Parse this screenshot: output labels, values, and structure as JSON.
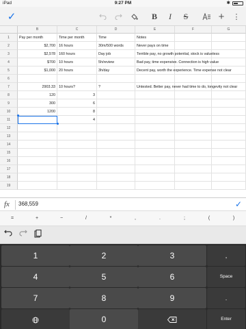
{
  "status_bar": {
    "device": "iPad",
    "time": "9:27 PM"
  },
  "toolbar": {
    "done_icon": "checkmark-icon",
    "undo_icon": "undo-icon",
    "redo_icon": "redo-icon",
    "fill_icon": "paint-bucket-icon",
    "bold_label": "B",
    "italic_label": "I",
    "strike_label": "S",
    "format_icon": "text-format-icon",
    "add_icon": "plus-icon",
    "more_icon": "more-vert-icon"
  },
  "sheet": {
    "columns": [
      "B",
      "C",
      "D",
      "E",
      "F",
      "G"
    ],
    "rows": [
      "1",
      "2",
      "3",
      "4",
      "5",
      "6",
      "7",
      "8",
      "9",
      "10",
      "11",
      "12",
      "13",
      "14",
      "15",
      "16",
      "17",
      "18",
      "19"
    ],
    "header_row": {
      "b": "Pay per month",
      "c": "Time per month",
      "d": "Time",
      "e": "Notes"
    },
    "data": [
      {
        "row": 2,
        "b": "$2,700",
        "c": "16 hours",
        "d": "30m/500 words",
        "e": "Never pays on time"
      },
      {
        "row": 3,
        "b": "$2,578",
        "c": "160 hours",
        "d": "Day job",
        "e": "Terrible pay, no growth potential, stock is valueless"
      },
      {
        "row": 4,
        "b": "$700",
        "c": "10 hours",
        "d": "5h/review",
        "e": "Bad pay, time expensive. Connection is high value"
      },
      {
        "row": 5,
        "b": "$1,000",
        "c": "20 hours",
        "d": "3h/day",
        "e": "Decent pay, worth the experience. Time expense not clear"
      },
      {
        "row": 7,
        "b": "2903.33",
        "c": "10 hours?",
        "d": "?",
        "e": "Untested. Better pay, never had time to do, longevity not clear"
      },
      {
        "row": 8,
        "b": "120",
        "c": "3",
        "d": "",
        "e": ""
      },
      {
        "row": 9,
        "b": "300",
        "c": "6",
        "d": "",
        "e": ""
      },
      {
        "row": 10,
        "b": "1200",
        "c": "8",
        "d": "",
        "e": ""
      },
      {
        "row": 11,
        "b": "",
        "c": "4",
        "d": "",
        "e": ""
      }
    ]
  },
  "formula_bar": {
    "fx_label": "fx",
    "value": "368,559",
    "confirm_icon": "checkmark-icon"
  },
  "symbols": [
    "=",
    "+",
    "−",
    "/",
    "*",
    ",",
    ".",
    ";",
    "(",
    ")"
  ],
  "edit_row": {
    "undo_icon": "undo-icon",
    "redo_icon": "redo-icon",
    "paste_icon": "clipboard-icon"
  },
  "keypad": {
    "digits": [
      "1",
      "2",
      "3",
      "4",
      "5",
      "6",
      "7",
      "8",
      "9",
      "0"
    ],
    "comma": ",",
    "space": "Space",
    "period": ".",
    "globe_icon": "globe-icon",
    "backspace_icon": "backspace-icon",
    "enter": "Enter"
  },
  "colors": {
    "accent": "#1a73e8",
    "keypad_bg": "#2a2a2a",
    "key_bg": "#4a4a4a"
  }
}
